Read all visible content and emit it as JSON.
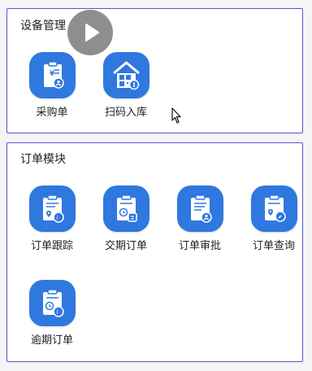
{
  "sections": [
    {
      "title": "设备管理",
      "items": [
        {
          "label": "采购单",
          "icon": "purchase-order-icon"
        },
        {
          "label": "扫码入库",
          "icon": "scan-warehouse-icon"
        }
      ]
    },
    {
      "title": "订单模块",
      "items": [
        {
          "label": "订单跟踪",
          "icon": "order-tracking-icon"
        },
        {
          "label": "交期订单",
          "icon": "delivery-order-icon"
        },
        {
          "label": "订单审批",
          "icon": "order-approval-icon"
        },
        {
          "label": "订单查询",
          "icon": "order-query-icon"
        },
        {
          "label": "逾期订单",
          "icon": "overdue-order-icon"
        }
      ]
    }
  ],
  "overlay": {
    "play_icon": "play-icon",
    "cursor_icon": "mouse-cursor-icon"
  },
  "colors": {
    "accent": "#2f78e0",
    "border": "#5b54c9",
    "background": "#f4f5f7"
  }
}
